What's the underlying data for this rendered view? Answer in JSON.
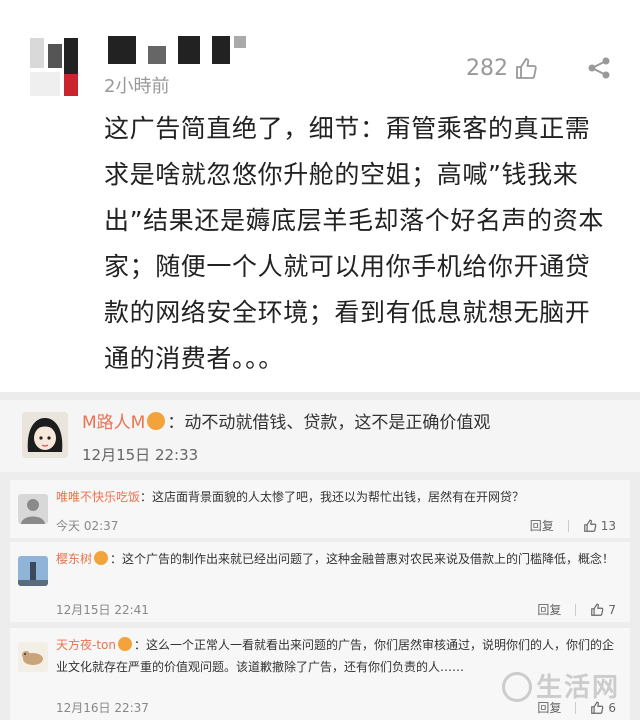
{
  "post": {
    "time": "2小時前",
    "like_count": "282",
    "text": "这广告简直绝了，细节：甭管乘客的真正需求是啥就忽悠你升舱的空姐；高喊”钱我来出”结果还是薅底层羊毛却落个好名声的资本家；随便一个人就可以用你手机给你开通贷款的网络安全环境；看到有低息就想无脑开通的消费者。。。"
  },
  "comment": {
    "user": "M路人M",
    "text": "：动不动就借钱、贷款，这不是正确价值观",
    "time": "12月15日 22:33"
  },
  "replies": [
    {
      "user": "唯唯不快乐吃饭",
      "text": "：这店面背景面貌的人太惨了吧，我还以为帮忙出钱，居然有在开网贷？",
      "time": "今天 02:37",
      "reply_label": "回复",
      "likes": "13"
    },
    {
      "user": "樱东树",
      "text": "：这个广告的制作出来就已经出问题了，这种金融普惠对农民来说及借款上的门槛降低，概念！",
      "time": "12月15日 22:41",
      "reply_label": "回复",
      "likes": "7"
    },
    {
      "user": "天方夜-ton",
      "text": "：这么一个正常人一看就看出来问题的广告，你们居然审核通过，说明你们的人，你们的企业文化就存在严重的价值观问题。该道歉撤除了广告，还有你们负责的人……",
      "time": "12月16日 22:37",
      "reply_label": "回复",
      "likes": "6"
    }
  ],
  "watermark": "生活网"
}
